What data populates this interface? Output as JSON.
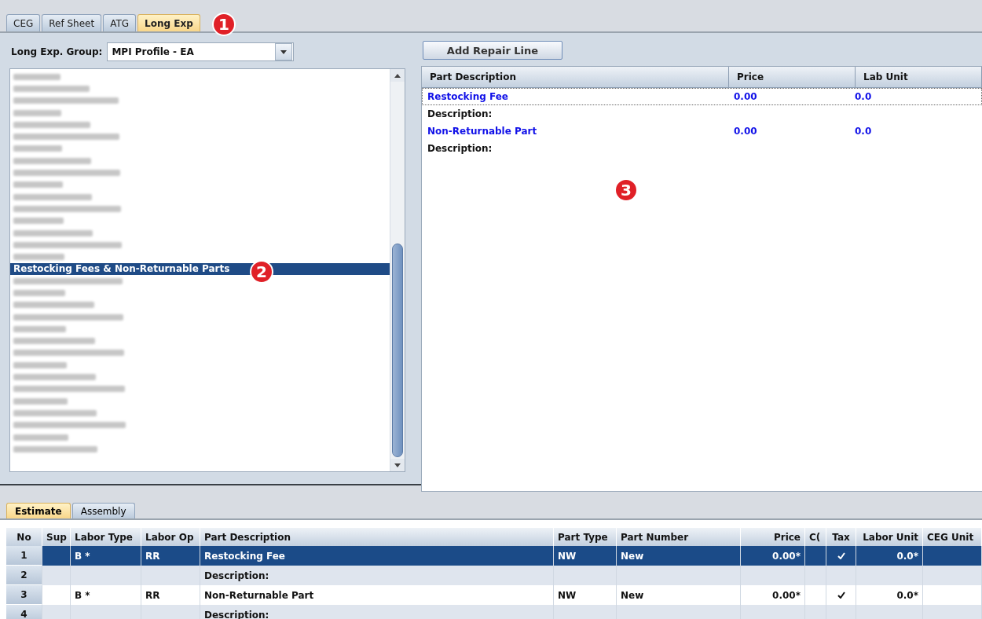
{
  "top_tabs": [
    {
      "label": "CEG",
      "selected": false
    },
    {
      "label": "Ref Sheet",
      "selected": false
    },
    {
      "label": "ATG",
      "selected": false
    },
    {
      "label": "Long Exp",
      "selected": true
    }
  ],
  "group_field": {
    "label": "Long Exp. Group:",
    "value": "MPI Profile - EA"
  },
  "group_list": {
    "items": [
      {
        "kind": "redacted",
        "selected": false
      },
      {
        "kind": "redacted",
        "selected": false
      },
      {
        "kind": "redacted",
        "selected": false
      },
      {
        "kind": "redacted",
        "selected": false
      },
      {
        "kind": "redacted",
        "selected": false
      },
      {
        "kind": "redacted",
        "selected": false
      },
      {
        "kind": "redacted",
        "selected": false
      },
      {
        "kind": "redacted",
        "selected": false
      },
      {
        "kind": "redacted",
        "selected": false
      },
      {
        "kind": "redacted",
        "selected": false
      },
      {
        "kind": "redacted",
        "selected": false
      },
      {
        "kind": "redacted",
        "selected": false
      },
      {
        "kind": "redacted",
        "selected": false
      },
      {
        "kind": "redacted",
        "selected": false
      },
      {
        "kind": "redacted",
        "selected": false
      },
      {
        "kind": "redacted",
        "selected": false
      },
      {
        "kind": "text",
        "label": "Restocking Fees & Non-Returnable Parts",
        "selected": true
      },
      {
        "kind": "redacted",
        "selected": false
      },
      {
        "kind": "redacted",
        "selected": false
      },
      {
        "kind": "redacted",
        "selected": false
      },
      {
        "kind": "redacted",
        "selected": false
      },
      {
        "kind": "redacted",
        "selected": false
      },
      {
        "kind": "redacted",
        "selected": false
      },
      {
        "kind": "redacted",
        "selected": false
      },
      {
        "kind": "redacted",
        "selected": false
      },
      {
        "kind": "redacted",
        "selected": false
      },
      {
        "kind": "redacted",
        "selected": false
      },
      {
        "kind": "redacted",
        "selected": false
      },
      {
        "kind": "redacted",
        "selected": false
      },
      {
        "kind": "redacted",
        "selected": false
      },
      {
        "kind": "redacted",
        "selected": false
      },
      {
        "kind": "redacted",
        "selected": false
      }
    ]
  },
  "add_button": "Add Repair Line",
  "repair_grid": {
    "columns": [
      "Part Description",
      "Price",
      "Lab Unit"
    ],
    "rows": [
      {
        "kind": "part",
        "cells": [
          "Restocking Fee",
          "0.00",
          "0.0"
        ],
        "selected": true
      },
      {
        "kind": "description",
        "cells": [
          "Description:"
        ],
        "selected": false
      },
      {
        "kind": "part",
        "cells": [
          "Non-Returnable Part",
          "0.00",
          "0.0"
        ],
        "selected": false
      },
      {
        "kind": "description",
        "cells": [
          "Description:"
        ],
        "selected": false
      }
    ]
  },
  "bottom_tabs": [
    {
      "label": "Estimate",
      "selected": true
    },
    {
      "label": "Assembly",
      "selected": false
    }
  ],
  "estimate": {
    "columns": [
      "No",
      "Sup",
      "Labor Type",
      "Labor Op",
      "Part Description",
      "Part Type",
      "Part Number",
      "Price",
      "C(",
      "Tax",
      "Labor Unit",
      "CEG Unit"
    ],
    "rows": [
      {
        "kind": "part",
        "selected": true,
        "no": "1",
        "labor_type": "B *",
        "labor_op": "RR",
        "part_description": "Restocking Fee",
        "part_type": "NW",
        "part_number": "New",
        "price": "0.00*",
        "tax": true,
        "labor_unit": "0.0*"
      },
      {
        "kind": "description",
        "selected": false,
        "no": "2",
        "part_description": "Description:"
      },
      {
        "kind": "part",
        "selected": false,
        "no": "3",
        "labor_type": "B *",
        "labor_op": "RR",
        "part_description": "Non-Returnable Part",
        "part_type": "NW",
        "part_number": "New",
        "price": "0.00*",
        "tax": true,
        "labor_unit": "0.0*"
      },
      {
        "kind": "description",
        "selected": false,
        "no": "4",
        "part_description": "Description:"
      }
    ]
  },
  "callouts": [
    "1",
    "2",
    "3"
  ]
}
